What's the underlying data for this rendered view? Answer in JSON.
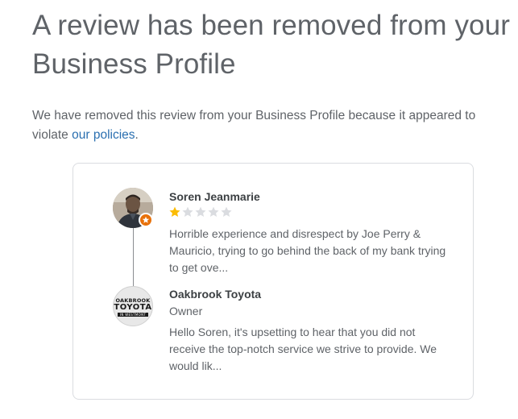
{
  "page": {
    "title": "A review has been removed from your Business Profile",
    "intro_text": "We have removed this review from your Business Profile because it appeared to violate ",
    "policies_link": "our policies",
    "intro_end": "."
  },
  "review": {
    "reviewer_name": "Soren Jeanmarie",
    "rating": 1,
    "max_rating": 5,
    "star_filled_color": "#fbbc04",
    "star_empty_color": "#dadce0",
    "text": "Horrible experience and disrespect by Joe Perry & Mauricio, trying to go behind the back of my bank trying to get ove..."
  },
  "reply": {
    "business_name": "Oakbrook Toyota",
    "role": "Owner",
    "text": "Hello Soren, it's upsetting to hear that you did not receive the top-notch service we strive to provide. We would lik...",
    "logo": {
      "line1": "OAKBROOK",
      "line2": "TOYOTA",
      "line3": "IN WESTMONT"
    }
  },
  "colors": {
    "link": "#2a6fb0",
    "badge": "#e8710a"
  }
}
